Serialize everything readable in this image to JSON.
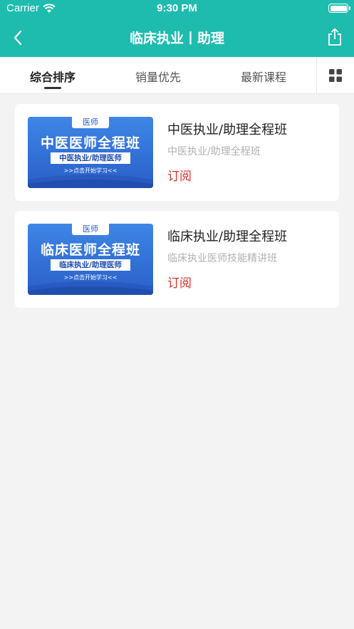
{
  "status_bar": {
    "carrier": "Carrier",
    "time": "9:30 PM"
  },
  "nav": {
    "title": "临床执业丨助理",
    "back_icon": "chevron-left-icon",
    "share_icon": "share-icon"
  },
  "tabs": [
    {
      "label": "综合排序",
      "active": true
    },
    {
      "label": "销量优先",
      "active": false
    },
    {
      "label": "最新课程",
      "active": false
    }
  ],
  "layout_toggle_icon": "grid-icon",
  "courses": [
    {
      "title": "中医执业/助理全程班",
      "subtitle": "中医执业/助理全程班",
      "action": "订阅",
      "thumb": {
        "ribbon": "医师",
        "headline": "中医医师全程班",
        "band": "中医执业/助理医师",
        "footer": ">>点击开始学习<<"
      }
    },
    {
      "title": "临床执业/助理全程班",
      "subtitle": "临床执业医师技能精讲班",
      "action": "订阅",
      "thumb": {
        "ribbon": "医师",
        "headline": "临床医师全程班",
        "band": "临床执业/助理医师",
        "footer": ">>点击开始学习<<"
      }
    }
  ],
  "colors": {
    "accent": "#1ebcaf",
    "subscribe": "#d9312b",
    "background": "#f3f3f3"
  }
}
